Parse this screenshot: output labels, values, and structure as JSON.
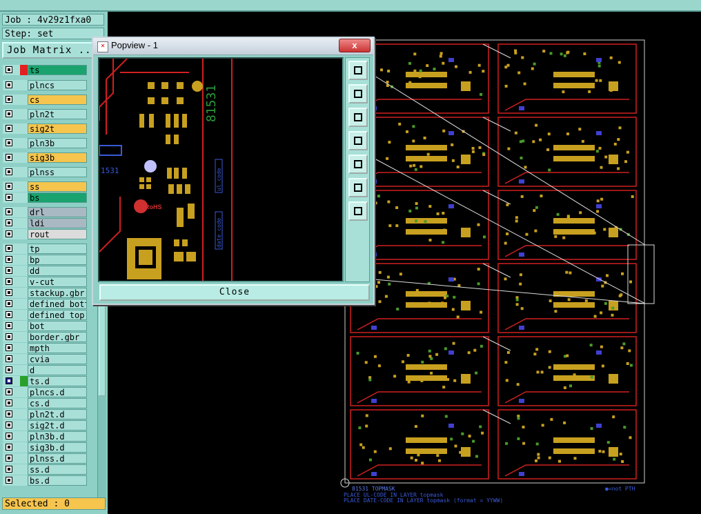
{
  "job_label": "Job : 4v29z1fxa0",
  "step_label": "Step: set",
  "job_matrix_label": "Job Matrix ...",
  "selected_label": "Selected : 0",
  "layers": [
    {
      "name": "ts",
      "color": "#1aa36e",
      "side": "#e32020",
      "blue": false
    },
    {
      "name": "plncs",
      "color": "#a8e0d8",
      "side": "",
      "blue": false
    },
    {
      "name": "cs",
      "color": "#f6c54e",
      "side": "",
      "blue": false
    },
    {
      "name": "pln2t",
      "color": "#a8e0d8",
      "side": "",
      "blue": false
    },
    {
      "name": "sig2t",
      "color": "#f6c54e",
      "side": "",
      "blue": false
    },
    {
      "name": "pln3b",
      "color": "#a8e0d8",
      "side": "",
      "blue": false
    },
    {
      "name": "sig3b",
      "color": "#f6c54e",
      "side": "",
      "blue": false
    },
    {
      "name": "plnss",
      "color": "#a8e0d8",
      "side": "",
      "blue": false
    },
    {
      "name": "ss",
      "color": "#f6c54e",
      "side": "",
      "blue": false
    },
    {
      "name": "bs",
      "color": "#1aa36e",
      "side": "",
      "blue": false
    },
    {
      "name": "drl",
      "color": "#a9b9c4",
      "side": "",
      "blue": false
    },
    {
      "name": "ldi",
      "color": "#a9b9c4",
      "side": "",
      "blue": false
    },
    {
      "name": "rout",
      "color": "#dcdcdc",
      "side": "",
      "blue": false
    },
    {
      "name": "tp",
      "color": "#a8e0d8",
      "side": "",
      "blue": false
    },
    {
      "name": "bp",
      "color": "#a8e0d8",
      "side": "",
      "blue": false
    },
    {
      "name": "dd",
      "color": "#a8e0d8",
      "side": "",
      "blue": false
    },
    {
      "name": "v-cut",
      "color": "#a8e0d8",
      "side": "",
      "blue": false
    },
    {
      "name": "stackup.gbr",
      "color": "#a8e0d8",
      "side": "",
      "blue": false
    },
    {
      "name": "defined_bott",
      "color": "#a8e0d8",
      "side": "",
      "blue": false
    },
    {
      "name": "defined_top",
      "color": "#a8e0d8",
      "side": "",
      "blue": false
    },
    {
      "name": "bot",
      "color": "#a8e0d8",
      "side": "",
      "blue": false
    },
    {
      "name": "border.gbr",
      "color": "#a8e0d8",
      "side": "",
      "blue": false
    },
    {
      "name": "mpth",
      "color": "#a8e0d8",
      "side": "",
      "blue": false
    },
    {
      "name": "cvia",
      "color": "#a8e0d8",
      "side": "",
      "blue": false
    },
    {
      "name": "d",
      "color": "#a8e0d8",
      "side": "",
      "blue": false
    },
    {
      "name": "ts.d",
      "color": "#a8e0d8",
      "side": "#2aa02a",
      "blue": true
    },
    {
      "name": "plncs.d",
      "color": "#a8e0d8",
      "side": "",
      "blue": false
    },
    {
      "name": "cs.d",
      "color": "#a8e0d8",
      "side": "",
      "blue": false
    },
    {
      "name": "pln2t.d",
      "color": "#a8e0d8",
      "side": "",
      "blue": false
    },
    {
      "name": "sig2t.d",
      "color": "#a8e0d8",
      "side": "",
      "blue": false
    },
    {
      "name": "pln3b.d",
      "color": "#a8e0d8",
      "side": "",
      "blue": false
    },
    {
      "name": "sig3b.d",
      "color": "#a8e0d8",
      "side": "",
      "blue": false
    },
    {
      "name": "plnss.d",
      "color": "#a8e0d8",
      "side": "",
      "blue": false
    },
    {
      "name": "ss.d",
      "color": "#a8e0d8",
      "side": "",
      "blue": false
    },
    {
      "name": "bs.d",
      "color": "#a8e0d8",
      "side": "",
      "blue": false
    }
  ],
  "popup": {
    "title": "Popview - 1",
    "close_x": "x",
    "close_button": "Close",
    "view_text_1": "81531",
    "view_text_2": "1531",
    "view_rohs": "RoHS",
    "view_label_a": "ul_code",
    "view_label_b": "date_code"
  },
  "board": {
    "footer_line1": "81531   TOPMASK",
    "footer_line2": "PLACE UL-CODE IN LAYER topmask",
    "footer_line3": "PLACE DATE-CODE IN LAYER topmask (format = YYWW)",
    "legend": "●=not PTH"
  }
}
